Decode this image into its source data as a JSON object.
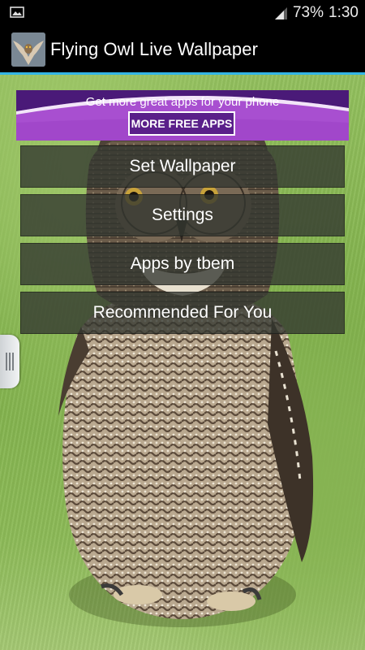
{
  "status_bar": {
    "battery_percent": "73%",
    "time": "1:30"
  },
  "action_bar": {
    "title": "Flying Owl Live Wallpaper",
    "icon": "owl-app-icon"
  },
  "ad_banner": {
    "tagline": "Get more great apps for your phone",
    "button_label": "MORE FREE APPS",
    "colors": {
      "background": "#a84fd0",
      "button": "#5a1f8a"
    }
  },
  "menu": {
    "items": [
      {
        "label": "Set Wallpaper"
      },
      {
        "label": "Settings"
      },
      {
        "label": "Apps by tbem"
      },
      {
        "label": "Recommended For You"
      }
    ]
  },
  "colors": {
    "accent": "#33b5e5",
    "grass": "#8cba57"
  }
}
